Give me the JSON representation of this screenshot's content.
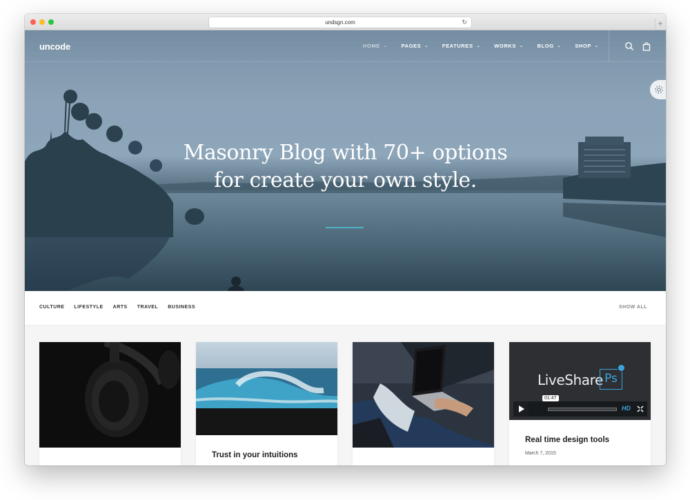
{
  "browser": {
    "url": "undsgn.com",
    "reload_glyph": "↻",
    "newtab_glyph": "+"
  },
  "site": {
    "logo": "uncode",
    "menu": [
      {
        "label": "HOME",
        "active": true
      },
      {
        "label": "PAGES",
        "active": false
      },
      {
        "label": "FEATURES",
        "active": false
      },
      {
        "label": "WORKS",
        "active": false
      },
      {
        "label": "BLOG",
        "active": false
      },
      {
        "label": "SHOP",
        "active": false
      }
    ],
    "icons": [
      "search-icon",
      "shopping-bag-icon",
      "gear-icon"
    ],
    "accent": "#4fb3c9"
  },
  "hero": {
    "line1": "Masonry Blog with 70+ options",
    "line2": "for create your own style."
  },
  "filters": {
    "items": [
      "CULTURE",
      "LIFESTYLE",
      "ARTS",
      "TRAVEL",
      "BUSINESS"
    ],
    "show_all": "SHOW ALL"
  },
  "cards": [
    {
      "image": "headphones",
      "title": "",
      "date": ""
    },
    {
      "image": "ocean-wave",
      "title": "Trust in your intuitions",
      "date": ""
    },
    {
      "image": "laptop",
      "title": "",
      "date": ""
    },
    {
      "image": "video",
      "title": "Real time design tools",
      "date": "March 7, 2015"
    }
  ],
  "video": {
    "brand": "LiveShare",
    "badge": "Ps",
    "time": "01:47",
    "hd": "HD"
  }
}
